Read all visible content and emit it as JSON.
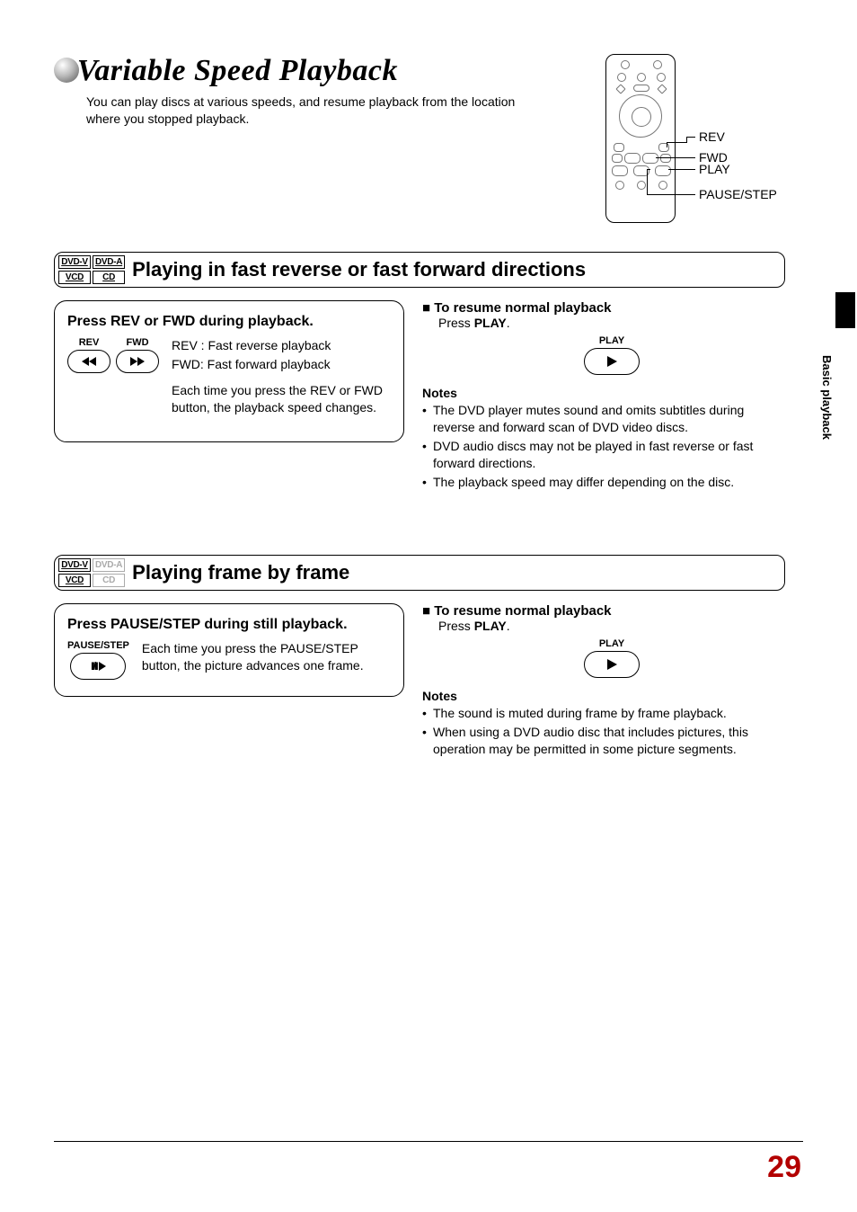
{
  "title": "Variable Speed Playback",
  "subtitle": "You can play discs at various speeds, and resume playback from the location where you stopped playback.",
  "side_tab": "Basic playback",
  "remote_labels": {
    "rev": "REV",
    "fwd": "FWD",
    "play": "PLAY",
    "pause": "PAUSE/STEP"
  },
  "section1": {
    "badges": {
      "dvdv": "DVD-V",
      "dvda": "DVD-A",
      "vcd": "VCD",
      "cd": "CD"
    },
    "heading": "Playing in fast reverse or fast forward directions",
    "panel_heading": "Press REV or FWD during playback.",
    "btn_rev": "REV",
    "btn_fwd": "FWD",
    "line1": "REV : Fast reverse playback",
    "line2": "FWD: Fast forward playback",
    "line3": "Each time you press the REV or FWD button, the playback speed changes.",
    "resume_h": "To resume normal playback",
    "resume_body": "Press ",
    "resume_bold": "PLAY",
    "resume_tail": ".",
    "play_label": "PLAY",
    "notes_h": "Notes",
    "notes": [
      "The DVD player mutes sound and omits subtitles during reverse and forward scan of DVD video discs.",
      "DVD audio discs may not be played in fast reverse or fast forward directions.",
      "The playback speed may differ depending on the disc."
    ]
  },
  "section2": {
    "badges": {
      "dvdv": "DVD-V",
      "dvda": "DVD-A",
      "vcd": "VCD",
      "cd": "CD"
    },
    "heading": "Playing frame by frame",
    "panel_heading": "Press PAUSE/STEP during still playback.",
    "btn_pause": "PAUSE/STEP",
    "panel_body": "Each time you press the PAUSE/STEP button, the picture advances one frame.",
    "resume_h": "To resume normal playback",
    "resume_body": "Press ",
    "resume_bold": "PLAY",
    "resume_tail": ".",
    "play_label": "PLAY",
    "notes_h": "Notes",
    "notes": [
      "The sound is muted during frame by frame playback.",
      "When using a DVD audio disc that includes pictures, this operation may be permitted in some picture segments."
    ]
  },
  "page_number": "29"
}
